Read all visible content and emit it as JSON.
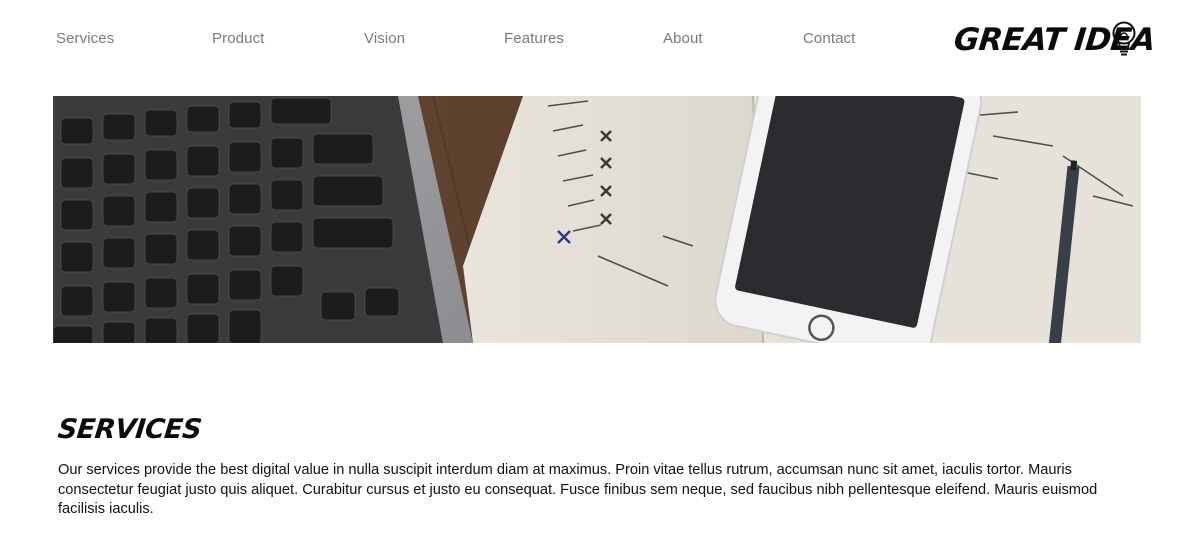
{
  "nav": {
    "items": [
      {
        "label": "Services"
      },
      {
        "label": "Product"
      },
      {
        "label": "Vision"
      },
      {
        "label": "Features"
      },
      {
        "label": "About"
      },
      {
        "label": "Contact"
      }
    ]
  },
  "logo": {
    "text": "GREAT IDEA",
    "icon": "lightbulb-icon"
  },
  "hero": {
    "image": "laptop-keyboard-notebook-phone-photo"
  },
  "section": {
    "title": "SERVICES",
    "body": "Our services provide the best digital value in nulla suscipit interdum diam at maximus. Proin vitae tellus rutrum, accumsan nunc sit amet, iaculis tortor. Mauris consectetur feugiat justo quis aliquet. Curabitur cursus et justo eu consequat. Fusce finibus sem neque, sed faucibus nibh pellentesque eleifend. Mauris euismod facilisis iaculis."
  }
}
